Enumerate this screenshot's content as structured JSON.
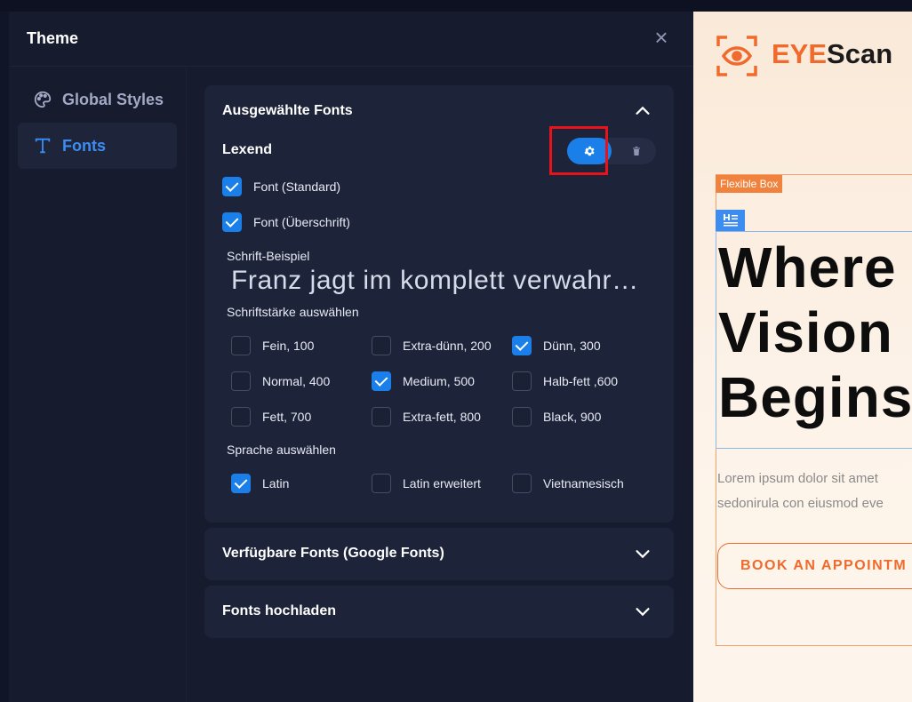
{
  "panel": {
    "title": "Theme"
  },
  "sidebar": {
    "items": [
      {
        "label": "Global Styles",
        "icon": "palette-icon",
        "active": false
      },
      {
        "label": "Fonts",
        "icon": "type-icon",
        "active": true
      }
    ]
  },
  "selected_fonts": {
    "title": "Ausgewählte Fonts",
    "font_name": "Lexend",
    "usage": [
      {
        "label": "Font (Standard)",
        "checked": true
      },
      {
        "label": "Font (Überschrift)",
        "checked": true
      }
    ],
    "sample_label": "Schrift-Beispiel",
    "sample_text": "Franz jagt im komplett verwahrlosten Taxi quer durch Bayern",
    "weight_label": "Schriftstärke auswählen",
    "weights": [
      {
        "label": "Fein, 100",
        "checked": false
      },
      {
        "label": "Extra-dünn, 200",
        "checked": false
      },
      {
        "label": "Dünn, 300",
        "checked": true
      },
      {
        "label": "Normal, 400",
        "checked": false
      },
      {
        "label": "Medium, 500",
        "checked": true
      },
      {
        "label": "Halb-fett ,600",
        "checked": false
      },
      {
        "label": "Fett, 700",
        "checked": false
      },
      {
        "label": "Extra-fett, 800",
        "checked": false
      },
      {
        "label": "Black, 900",
        "checked": false
      }
    ],
    "language_label": "Sprache auswählen",
    "languages": [
      {
        "label": "Latin",
        "checked": true
      },
      {
        "label": "Latin erweitert",
        "checked": false
      },
      {
        "label": "Vietnamesisch",
        "checked": false
      }
    ]
  },
  "available_fonts": {
    "title": "Verfügbare Fonts (Google Fonts)"
  },
  "upload_fonts": {
    "title": "Fonts hochladen"
  },
  "preview": {
    "logo_eye": "EYE",
    "logo_scan": "Scan",
    "flex_tag": "Flexible Box",
    "hero_lines": [
      "Where",
      "Vision",
      "Begins"
    ],
    "lorem_lines": [
      "Lorem ipsum dolor sit amet",
      "sedonirula con eiusmod eve"
    ],
    "button": "BOOK AN APPOINTM"
  },
  "colors": {
    "accent": "#1a7fe8",
    "brand": "#ef6a2c",
    "panel": "#161b2e",
    "card": "#1d2338"
  }
}
